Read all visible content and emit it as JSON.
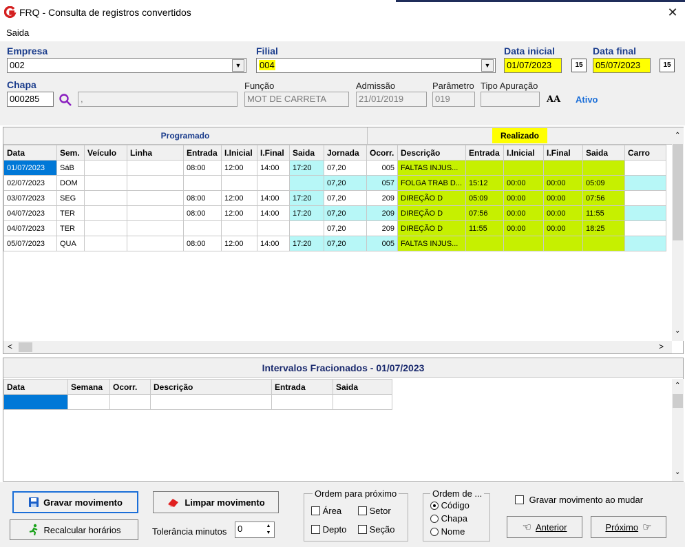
{
  "window": {
    "title": "FRQ - Consulta de registros convertidos",
    "close_glyph": "✕"
  },
  "menu": {
    "saida": "Saida"
  },
  "filters": {
    "empresa_label": "Empresa",
    "empresa_value": "002",
    "filial_label": "Filial",
    "filial_value": "004",
    "data_inicial_label": "Data inicial",
    "data_inicial_value": "01/07/2023",
    "data_final_label": "Data final",
    "data_final_value": "05/07/2023",
    "calendar_glyph": "15",
    "chapa_label": "Chapa",
    "chapa_value": "000285",
    "nome_value": ",",
    "funcao_label": "Função",
    "funcao_value": "MOT DE CARRETA",
    "admissao_label": "Admissão",
    "admissao_value": "21/01/2019",
    "parametro_label": "Parâmetro",
    "parametro_value": "019",
    "tipo_apuracao_label": "Tipo Apuração",
    "tipo_apuracao_value": "",
    "status": "Ativo",
    "font_icon_text": "AA"
  },
  "grid": {
    "group_programado": "Programado",
    "group_realizado": "Realizado",
    "columns": [
      "Data",
      "Sem.",
      "Veículo",
      "Linha",
      "Entrada",
      "I.Inicial",
      "I.Final",
      "Saida",
      "Jornada",
      "Ocorr.",
      "Descrição",
      "Entrada",
      "I.Inicial",
      "I.Final",
      "Saida",
      "Carro"
    ],
    "rows": [
      [
        "01/07/2023",
        "SáB",
        "",
        "",
        "08:00",
        "12:00",
        "14:00",
        "17:20",
        "07,20",
        "005",
        "FALTAS INJUS...",
        "",
        "",
        "",
        "",
        ""
      ],
      [
        "02/07/2023",
        "DOM",
        "",
        "",
        "",
        "",
        "",
        "",
        "07,20",
        "057",
        "FOLGA TRAB D...",
        "15:12",
        "00:00",
        "00:00",
        "05:09",
        ""
      ],
      [
        "03/07/2023",
        "SEG",
        "",
        "",
        "08:00",
        "12:00",
        "14:00",
        "17:20",
        "07,20",
        "209",
        "DIREÇÃO D",
        "05:09",
        "00:00",
        "00:00",
        "07:56",
        ""
      ],
      [
        "04/07/2023",
        "TER",
        "",
        "",
        "08:00",
        "12:00",
        "14:00",
        "17:20",
        "07,20",
        "209",
        "DIREÇÃO D",
        "07:56",
        "00:00",
        "00:00",
        "11:55",
        ""
      ],
      [
        "04/07/2023",
        "TER",
        "",
        "",
        "",
        "",
        "",
        "",
        "07,20",
        "209",
        "DIREÇÃO D",
        "11:55",
        "00:00",
        "00:00",
        "18:25",
        ""
      ],
      [
        "05/07/2023",
        "QUA",
        "",
        "",
        "08:00",
        "12:00",
        "14:00",
        "17:20",
        "07,20",
        "005",
        "FALTAS INJUS...",
        "",
        "",
        "",
        "",
        ""
      ]
    ]
  },
  "intervals": {
    "title": "Intervalos Fracionados - 01/07/2023",
    "columns": [
      "Data",
      "Semana",
      "Ocorr.",
      "Descrição",
      "Entrada",
      "Saida"
    ]
  },
  "bottom": {
    "gravar_label": "Gravar movimento",
    "limpar_label": "Limpar movimento",
    "recalcular_label": "Recalcular horários",
    "tolerancia_label": "Tolerância minutos",
    "tolerancia_value": "0",
    "ordem_proximo_title": "Ordem para próximo",
    "chk_area": "Área",
    "chk_setor": "Setor",
    "chk_depto": "Depto",
    "chk_secao": "Seção",
    "ordem_de_title": "Ordem de ...",
    "radio_codigo": "Código",
    "radio_chapa": "Chapa",
    "radio_nome": "Nome",
    "gravar_ao_mudar": "Gravar movimento ao mudar",
    "anterior_label": "Anterior",
    "proximo_label": "Próximo"
  },
  "colors": {
    "highlight": "#ffff00",
    "realizado_green": "#c6f000",
    "programado_cyan": "#b7f7f7",
    "accent_blue": "#1a3c8c"
  }
}
